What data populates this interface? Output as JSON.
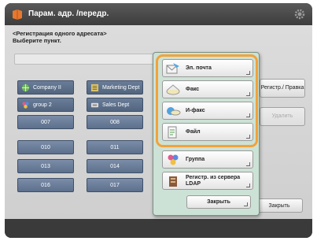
{
  "window": {
    "title": "Парам. адр. /передр."
  },
  "instruction": {
    "line1": "<Регистрация одного адресата>",
    "line2": "Выберите пункт."
  },
  "grid": {
    "cells": [
      {
        "label": "Company II",
        "icon": "globe-icon"
      },
      {
        "label": "Marketing Dept",
        "icon": "list-icon"
      },
      {
        "label": "group 2",
        "icon": "group-icon"
      },
      {
        "label": "Sales Dept",
        "icon": "network-icon"
      },
      {
        "label": "007",
        "icon": ""
      },
      {
        "label": "008",
        "icon": ""
      },
      {
        "label": "010",
        "icon": ""
      },
      {
        "label": "011",
        "icon": ""
      },
      {
        "label": "013",
        "icon": ""
      },
      {
        "label": "014",
        "icon": ""
      },
      {
        "label": "016",
        "icon": ""
      },
      {
        "label": "017",
        "icon": ""
      }
    ]
  },
  "side_buttons": {
    "register": "Регистр./ Правка",
    "delete": "Удалить",
    "close": "Закрыть"
  },
  "popup": {
    "items": [
      {
        "label": "Эл. почта",
        "icon": "email-icon"
      },
      {
        "label": "Факс",
        "icon": "fax-icon"
      },
      {
        "label": "И-факс",
        "icon": "ifax-icon"
      },
      {
        "label": "Файл",
        "icon": "file-icon"
      },
      {
        "label": "Группа",
        "icon": "group-icon"
      },
      {
        "label": "Регистр. из сервера LDAP",
        "icon": "ldap-icon"
      }
    ],
    "close_label": "Закрыть"
  },
  "colors": {
    "highlight": "#f2a23a",
    "popup_bg": "#cde2d6",
    "grid_cell": "#6a7d99"
  }
}
